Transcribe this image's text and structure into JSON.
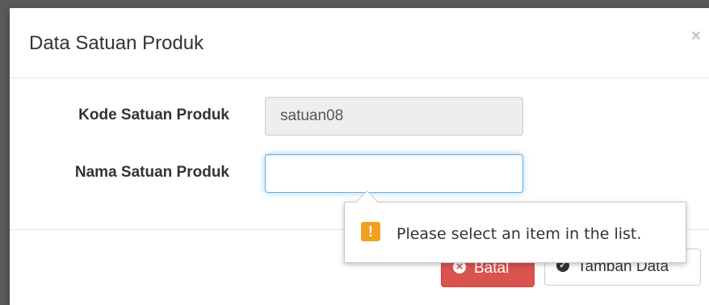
{
  "modal": {
    "title": "Data Satuan Produk",
    "close_symbol": "×"
  },
  "form": {
    "kode": {
      "label": "Kode Satuan Produk",
      "value": "satuan08"
    },
    "nama": {
      "label": "Nama Satuan Produk",
      "value": "",
      "placeholder": ""
    }
  },
  "buttons": {
    "batal_label": "Batal",
    "batal_icon": "times-circle-icon",
    "tambah_label": "Tambah Data",
    "tambah_icon": "check-circle-icon"
  },
  "validation_tooltip": {
    "message": "Please select an item in the list.",
    "icon": "warning-icon",
    "icon_glyph": "!"
  },
  "colors": {
    "danger": "#d9534f",
    "focus_border": "#66afe9",
    "warning": "#f0a020"
  }
}
